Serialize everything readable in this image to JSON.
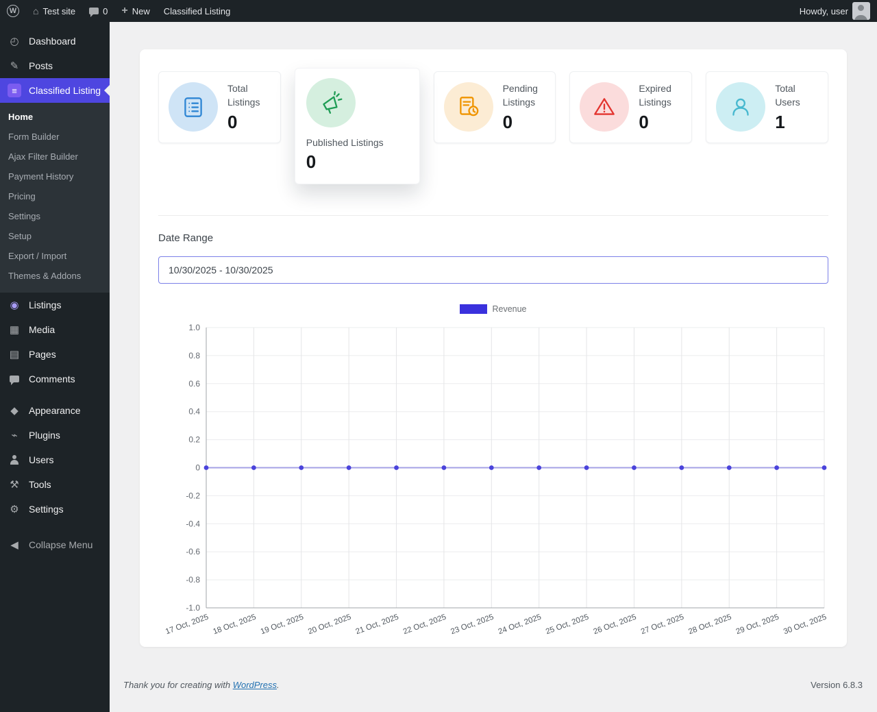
{
  "admin_bar": {
    "wp_logo_letter": "W",
    "site_name": "Test site",
    "comments_count": "0",
    "new_label": "New",
    "plugin_link": "Classified Listing",
    "howdy": "Howdy, user"
  },
  "theme": {
    "accent": "#4e46e0",
    "badge_bg": "#7b5cf0",
    "listings_icon_color": "#a79af5",
    "input_border": "#7b80e8",
    "link_color": "#2271b1"
  },
  "sidebar": {
    "menu": [
      {
        "label": "Dashboard",
        "glyph": "◴"
      },
      {
        "label": "Posts",
        "glyph": "✎"
      },
      {
        "label": "Classified Listing",
        "glyph": "≡",
        "active": true
      },
      {
        "label": "Listings",
        "glyph": "◉"
      },
      {
        "label": "Media",
        "glyph": "▦"
      },
      {
        "label": "Pages",
        "glyph": "▤"
      },
      {
        "label": "Comments",
        "glyph": ""
      },
      {
        "label": "Appearance",
        "glyph": "◆"
      },
      {
        "label": "Plugins",
        "glyph": "⌁"
      },
      {
        "label": "Users",
        "glyph": ""
      },
      {
        "label": "Tools",
        "glyph": "⚒"
      },
      {
        "label": "Settings",
        "glyph": "⚙"
      }
    ],
    "submenu": [
      {
        "label": "Home",
        "current": true
      },
      {
        "label": "Form Builder"
      },
      {
        "label": "Ajax Filter Builder"
      },
      {
        "label": "Payment History"
      },
      {
        "label": "Pricing"
      },
      {
        "label": "Settings"
      },
      {
        "label": "Setup"
      },
      {
        "label": "Export / Import"
      },
      {
        "label": "Themes & Addons"
      }
    ],
    "collapse_label": "Collapse Menu"
  },
  "stats": [
    {
      "label": "Total Listings",
      "value": "0",
      "bg": "#cfe4f6",
      "color": "#2f86d4"
    },
    {
      "label": "Published Listings",
      "value": "0",
      "bg": "#d5efdf",
      "color": "#1f9d55"
    },
    {
      "label": "Pending Listings",
      "value": "0",
      "bg": "#fcecd4",
      "color": "#ef9400"
    },
    {
      "label": "Expired Listings",
      "value": "0",
      "bg": "#fbdcdc",
      "color": "#e3342f"
    },
    {
      "label": "Total Users",
      "value": "1",
      "bg": "#cdeef3",
      "color": "#47b8cf"
    }
  ],
  "date_range": {
    "label": "Date Range",
    "value": "10/30/2025 - 10/30/2025"
  },
  "chart_data": {
    "type": "line",
    "title": "",
    "x": [
      "17 Oct, 2025",
      "18 Oct, 2025",
      "19 Oct, 2025",
      "20 Oct, 2025",
      "21 Oct, 2025",
      "22 Oct, 2025",
      "23 Oct, 2025",
      "24 Oct, 2025",
      "25 Oct, 2025",
      "26 Oct, 2025",
      "27 Oct, 2025",
      "28 Oct, 2025",
      "29 Oct, 2025",
      "30 Oct, 2025"
    ],
    "series": [
      {
        "name": "Revenue",
        "values": [
          0,
          0,
          0,
          0,
          0,
          0,
          0,
          0,
          0,
          0,
          0,
          0,
          0,
          0
        ]
      }
    ],
    "ylim": [
      -1.0,
      1.0
    ],
    "yticks": [
      "1.0",
      "0.8",
      "0.6",
      "0.4",
      "0.2",
      "0",
      "-0.2",
      "-0.4",
      "-0.6",
      "-0.8",
      "-1.0"
    ],
    "grid": true,
    "legend_position": "top",
    "colors": {
      "legend": "#3a31dd",
      "line": "#a5a1e5",
      "point": "#4a43db"
    }
  },
  "footer": {
    "thanks_prefix": "Thank you for creating with ",
    "wordpress_link": "WordPress",
    "thanks_suffix": ".",
    "version": "Version 6.8.3"
  }
}
